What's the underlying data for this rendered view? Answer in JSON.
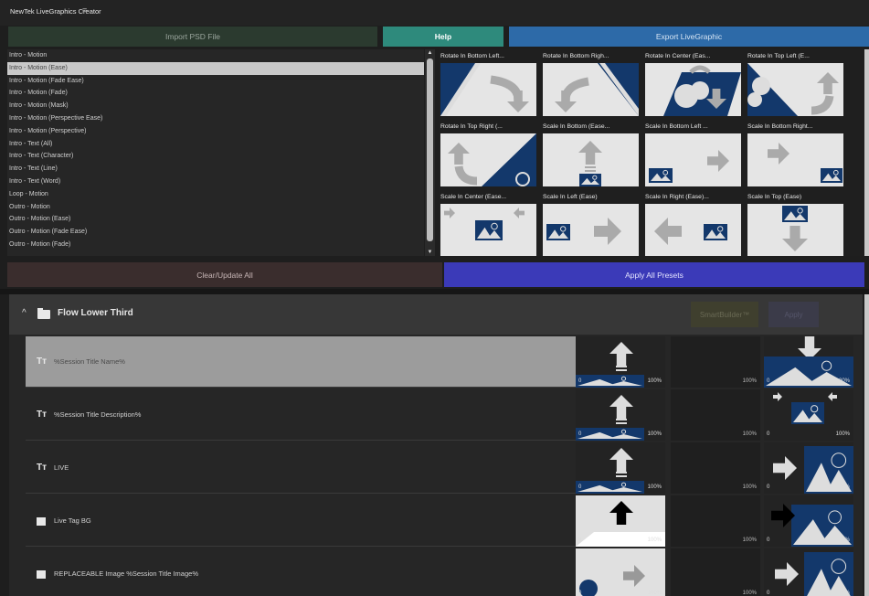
{
  "app": {
    "title": "NewTek LiveGraphics Creator",
    "menu_icon": "hamburger-icon"
  },
  "toolbar": {
    "import_label": "Import PSD File",
    "help_label": "Help",
    "export_label": "Export LiveGraphic"
  },
  "presets": [
    "Intro - Motion",
    "Intro - Motion (Ease)",
    "Intro - Motion (Fade Ease)",
    "Intro - Motion (Fade)",
    "Intro - Motion (Mask)",
    "Intro - Motion (Perspective Ease)",
    "Intro - Motion (Perspective)",
    "Intro - Text (All)",
    "Intro - Text (Character)",
    "Intro - Text (Line)",
    "Intro - Text (Word)",
    "Loop - Motion",
    "Outro - Motion",
    "Outro - Motion (Ease)",
    "Outro - Motion (Fade Ease)",
    "Outro - Motion (Fade)"
  ],
  "selected_preset": "Intro - Motion (Ease)",
  "thumbnails": [
    "Rotate In Bottom Left...",
    "Rotate In Bottom Righ...",
    "Rotate In Center (Eas...",
    "Rotate In Top Left (E...",
    "Rotate In Top Right (...",
    "Scale In Bottom (Ease...",
    "Scale In Bottom Left ...",
    "Scale In Bottom Right...",
    "Scale In Center (Ease...",
    "Scale In Left (Ease)",
    "Scale In Right (Ease)...",
    "Scale In Top (Ease)"
  ],
  "actions": {
    "clear_label": "Clear/Update All",
    "apply_all_label": "Apply All Presets"
  },
  "group": {
    "name": "Flow Lower Third",
    "smartbuilder_label": "SmartBuilder™",
    "apply_label": "Apply"
  },
  "layers": [
    {
      "type": "text",
      "name": "%Session Title Name%"
    },
    {
      "type": "text",
      "name": "%Session Title Description%"
    },
    {
      "type": "text",
      "name": "LIVE"
    },
    {
      "type": "image",
      "name": "Live Tag BG"
    },
    {
      "type": "image",
      "name": "REPLACEABLE Image %Session Title Image%"
    }
  ],
  "timing": {
    "start": "0",
    "end": "100%"
  },
  "colors": {
    "accent_blue": "#13386b",
    "help": "#2e8a7c",
    "export": "#2d6aa8",
    "apply_all": "#3b3ab8"
  }
}
